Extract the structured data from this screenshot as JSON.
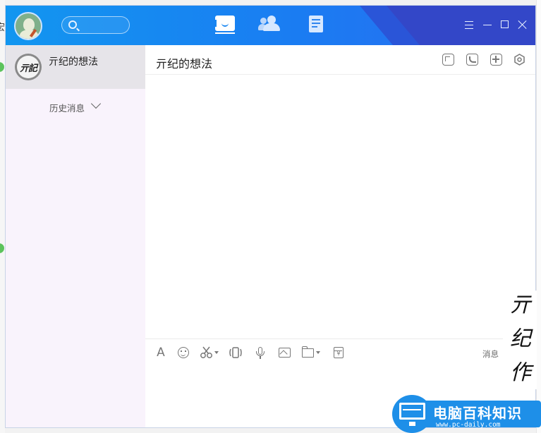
{
  "app": {
    "colors": {
      "titlebar": "#1a87f1",
      "titlebar_accent": "#3347c8",
      "sidebar_bg": "#f9f3fc",
      "selected_item_bg": "#e6e4e9",
      "brand_blue": "#1e8fe8"
    }
  },
  "titlebar": {
    "search_icon": "search-icon",
    "nav": [
      {
        "name": "messages",
        "icon": "chat-bubble-icon",
        "active": true
      },
      {
        "name": "contacts",
        "icon": "contacts-icon",
        "active": false
      },
      {
        "name": "apps",
        "icon": "document-icon",
        "active": false
      }
    ],
    "window_controls": [
      "menu-icon",
      "minimize-icon",
      "maximize-icon",
      "close-icon"
    ]
  },
  "sidebar": {
    "conversations": [
      {
        "name": "亓纪的想法",
        "avatar_text": "亓記",
        "selected": true
      }
    ],
    "history_label": "历史消息"
  },
  "chat": {
    "title": "亓纪的想法",
    "header_actions": [
      "share-screen-icon",
      "voice-call-icon",
      "add-member-icon",
      "settings-icon"
    ],
    "toolbar": {
      "font_glyph": "A",
      "tools": [
        "font-icon",
        "emoji-icon",
        "screenshot-icon",
        "shake-icon",
        "voice-icon",
        "image-icon",
        "file-icon",
        "red-packet-icon"
      ],
      "message_label": "消息"
    }
  },
  "watermark": {
    "handwriting": [
      "亓",
      "纪",
      "作"
    ],
    "site_name": "电脑百科知识",
    "site_url": "www.pc-daily.com"
  }
}
